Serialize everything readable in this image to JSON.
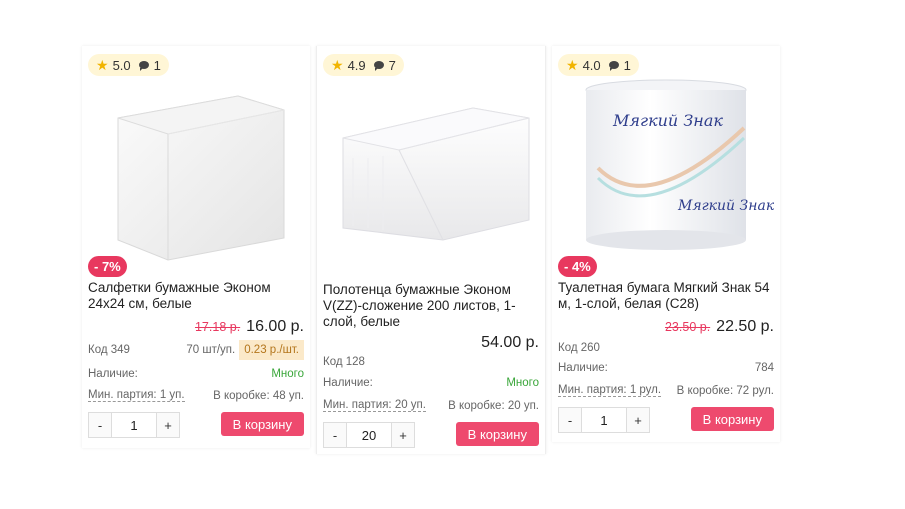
{
  "products": [
    {
      "rating": "5.0",
      "reviews": "1",
      "discount": "- 7%",
      "title": "Салфетки бумажные Эконом 24х24 см, белые",
      "old_price": "17.18 р.",
      "price": "16.00 р.",
      "code": "Код 349",
      "pack_info": "70 шт/уп.",
      "unit_price": "0.23 р./шт.",
      "stock_label": "Наличие:",
      "stock_value": "Много",
      "min_lot": "Мин. партия: 1 уп.",
      "box_info": "В коробке: 48 уп.",
      "qty": "1",
      "qty_minus": "-",
      "qty_plus": "+",
      "cart_label": "В корзину"
    },
    {
      "rating": "4.9",
      "reviews": "7",
      "title": "Полотенца бумажные Эконом V(ZZ)-сложение 200 листов, 1-слой, белые",
      "price": "54.00 р.",
      "code": "Код 128",
      "stock_label": "Наличие:",
      "stock_value": "Много",
      "min_lot": "Мин. партия: 20 уп.",
      "box_info": "В коробке: 20 уп.",
      "qty": "20",
      "qty_minus": "-",
      "qty_plus": "+",
      "cart_label": "В корзину"
    },
    {
      "rating": "4.0",
      "reviews": "1",
      "discount": "- 4%",
      "title": "Туалетная бумага Мягкий Знак 54 м, 1-слой, белая (С28)",
      "old_price": "23.50 р.",
      "price": "22.50 р.",
      "code": "Код 260",
      "stock_label": "Наличие:",
      "stock_value": "784",
      "min_lot": "Мин. партия: 1 рул.",
      "box_info": "В коробке: 72 рул.",
      "qty": "1",
      "qty_minus": "-",
      "qty_plus": "+",
      "cart_label": "В корзину",
      "brand_text": "Мягкий Знак"
    }
  ]
}
